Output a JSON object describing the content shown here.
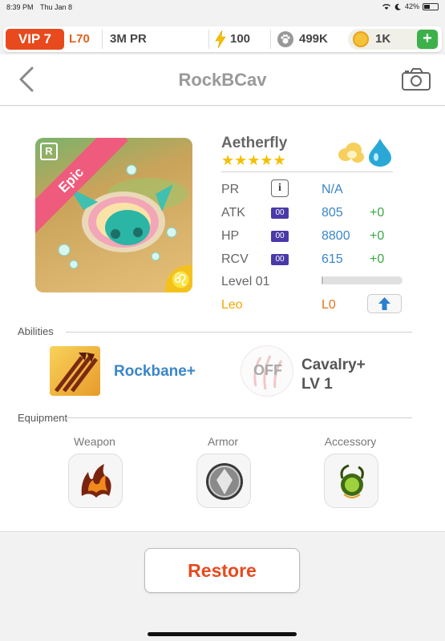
{
  "status_bar": {
    "time": "8:39 PM",
    "date": "Thu Jan 8",
    "battery": "42%"
  },
  "top_bar": {
    "vip": "VIP 7",
    "level": "L70",
    "power": "3M PR",
    "energy": "100",
    "food": "499K",
    "gold": "1K",
    "add": "+"
  },
  "nav": {
    "title": "RockBCav"
  },
  "monster": {
    "name": "Aetherfly",
    "stars": "★★★★★",
    "rarity": "Epic",
    "rank_badge": "R",
    "zodiac_symbol": "♌",
    "stats": [
      {
        "label": "PR",
        "value": "N/A",
        "plus": ""
      },
      {
        "label": "ATK",
        "badge": "00",
        "value": "805",
        "plus": "+0"
      },
      {
        "label": "HP",
        "badge": "00",
        "value": "8800",
        "plus": "+0"
      },
      {
        "label": "RCV",
        "badge": "00",
        "value": "615",
        "plus": "+0"
      }
    ],
    "info": "i",
    "level_label": "Level 01",
    "xp_progress": 0.02,
    "zodiac": "Leo",
    "zodiac_level": "L0"
  },
  "abilities": {
    "section": "Abilities",
    "ability_name": "Rockbane+",
    "off_label": "OFF",
    "cavalry_line1": "Cavalry+",
    "cavalry_line2": "LV 1"
  },
  "equipment": {
    "section": "Equipment",
    "slots": [
      "Weapon",
      "Armor",
      "Accessory"
    ]
  },
  "actions": {
    "restore": "Restore"
  },
  "colors": {
    "accent_orange": "#e8491d",
    "stat_blue": "#3a86c8",
    "plus_green": "#3aa845",
    "star_gold": "#f5c000"
  }
}
